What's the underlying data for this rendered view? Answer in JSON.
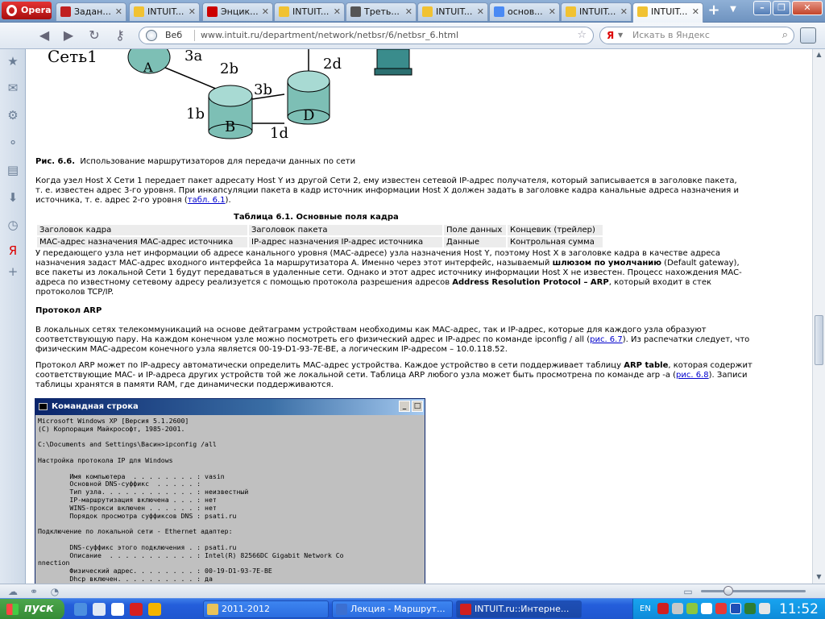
{
  "browser": {
    "opera_label": "Opera",
    "tabs": [
      {
        "label": "Задан...",
        "fav_color": "#c02020"
      },
      {
        "label": "INTUIT...",
        "fav_color": "#f1c232"
      },
      {
        "label": "Энцик...",
        "fav_color": "#cc0000"
      },
      {
        "label": "INTUIT...",
        "fav_color": "#f1c232"
      },
      {
        "label": "Треть...",
        "fav_color": "#555555"
      },
      {
        "label": "INTUIT...",
        "fav_color": "#f1c232"
      },
      {
        "label": "основ...",
        "fav_color": "#4a8af4"
      },
      {
        "label": "INTUIT...",
        "fav_color": "#f1c232"
      },
      {
        "label": "INTUIT...",
        "fav_color": "#f1c232",
        "active": true
      }
    ],
    "address_scheme": "Веб",
    "address_url": "www.intuit.ru/department/network/netbsr/6/netbsr_6.html",
    "search_engine": "Я",
    "search_placeholder": "Искать в Яндекс"
  },
  "article": {
    "fig_labels": {
      "net": "Сеть1",
      "a": "A",
      "b": "B",
      "d": "D",
      "l3a": "3a",
      "l2b": "2b",
      "l3b": "3b",
      "l1b": "1b",
      "l1d": "1d",
      "l2d": "2d"
    },
    "fig_caption_bold": "Рис. 6.6.",
    "fig_caption": "Использование маршрутизаторов для передачи данных по сети",
    "p1": [
      {
        "t": "Когда узел Host X Сети 1 передает пакет адресату Host Y из другой Сети 2, ему известен сетевой IP-адрес получателя, который записывается в заголовке пакета,"
      },
      {
        "t": "т. е. известен адрес 3-го уровня. При инкапсуляции пакета в кадр источник информации Host X должен задать в заголовке кадра канальные адреса назначения и"
      },
      {
        "t": "источника, т. е. адрес 2-го уровня (",
        "link": "табл. 6.1",
        "after": ")."
      }
    ],
    "table_caption": "Таблица 6.1. Основные поля кадра",
    "table": [
      [
        "Заголовок кадра",
        "Заголовок пакета",
        "Поле данных",
        "Концевик (трейлер)"
      ],
      [
        "MAC-адрес назначения MAC-адрес источника",
        "IP-адрес назначения IP-адрес источника",
        "Данные",
        "Контрольная сумма"
      ]
    ],
    "p2": [
      {
        "t": "У передающего узла нет информации об адресе канального уровня (MAC-адресе) узла назначения Host Y, поэтому Host X в заголовке кадра в качестве адреса"
      },
      {
        "t": "назначения задаст MAC-адрес входного интерфейса 1a маршрутизатора A. Именно через этот интерфейс, называемый ",
        "b": "шлюзом по умолчанию",
        "after": " (Default gateway),"
      },
      {
        "t": "все пакеты из локальной Сети 1 будут передаваться в удаленные сети. Однако и этот адрес источнику информации Host X не известен. Процесс нахождения MAC-"
      },
      {
        "t": "адреса по известному сетевому адресу реализуется с помощью протокола разрешения адресов ",
        "b": "Address Resolution Protocol – ARP",
        "after": ", который входит в стек"
      },
      {
        "t": "протоколов TCP/IP."
      }
    ],
    "h_arp": "Протокол ARP",
    "p3": [
      {
        "t": "В локальных сетях телекоммуникаций на основе дейтаграмм устройствам необходимы как MAC-адрес, так и IP-адрес, которые для каждого узла образуют"
      },
      {
        "t": "соответствующую пару. На каждом конечном узле можно посмотреть его физический адрес и IP-адрес по команде ipconfig / all (",
        "link": "рис. 6.7",
        "after": "). Из распечатки следует, что"
      },
      {
        "t": "физическим MAC-адресом конечного узла является 00-19-D1-93-7E-BE, а логическим IP-адресом – 10.0.118.52."
      }
    ],
    "p4": [
      {
        "t": "Протокол ARP может по IP-адресу автоматически определить MAC-адрес устройства. Каждое устройство в сети поддерживает таблицу ",
        "b": "ARP table",
        "after": ", которая содержит"
      },
      {
        "t": "соответствующие MAC- и IP-адреса других устройств той же локальной сети. Таблица ARP любого узла может быть просмотрена по команде arp -a (",
        "link": "рис. 6.8",
        "after": "). Записи"
      },
      {
        "t": "таблицы хранятся в памяти RAM, где динамически поддерживаются."
      }
    ],
    "cmd": {
      "title": "Командная строка",
      "lines": [
        "Microsoft Windows XP [Версия 5.1.2600]",
        "(C) Корпорация Майкрософт, 1985-2001.",
        "",
        "C:\\Documents and Settings\\Васин>ipconfig /all",
        "",
        "Настройка протокола IP для Windows",
        "",
        "        Имя компьютера  . . . . . . . . : vasin",
        "        Основной DNS-суффикс  . . . . . :",
        "        Тип узла. . . . . . . . . . . . : неизвестный",
        "        IP-маршрутизация включена . . . : нет",
        "        WINS-прокси включен . . . . . . : нет",
        "        Порядок просмотра суффиксов DNS : psati.ru",
        "",
        "Подключение по локальной сети - Ethernet адаптер:",
        "",
        "        DNS-суффикс этого подключения . : psati.ru",
        "        Описание  . . . . . . . . . . . : Intel(R) 82566DC Gigabit Network Co",
        "nnection",
        "        Физический адрес. . . . . . . . : 00-19-D1-93-7E-BE",
        "        Dhcp включен. . . . . . . . . . : да"
      ]
    }
  },
  "taskbar": {
    "start_label": "пуск",
    "tasks": [
      {
        "label": "2011-2012",
        "icon_color": "#e8c35a"
      },
      {
        "label": "Лекция - Маршрут...",
        "icon_color": "#3b6fd1"
      },
      {
        "label": "INTUIT.ru::Интерне...",
        "icon_color": "#d02020",
        "active": true
      }
    ],
    "lang": "EN",
    "clock": "11:52"
  }
}
